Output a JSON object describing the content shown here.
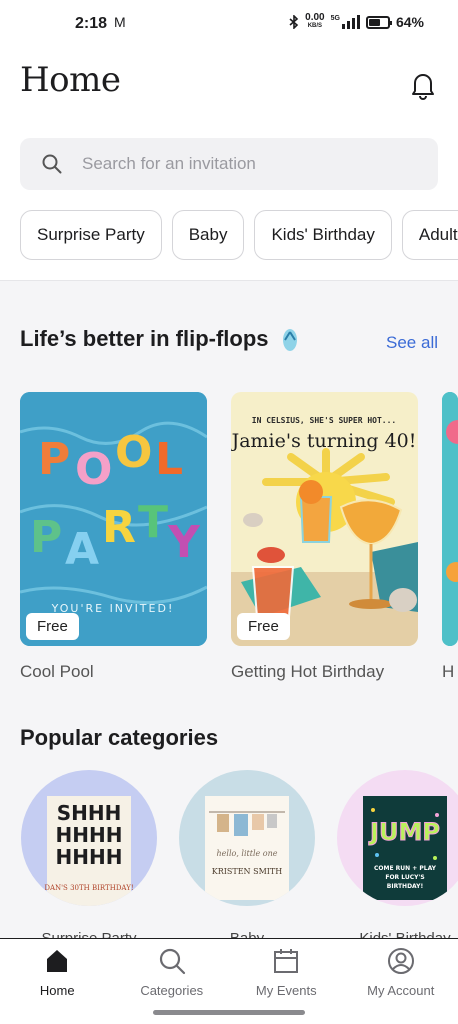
{
  "status_bar": {
    "time": "2:18",
    "mail_icon": "M",
    "speed_value": "0.00",
    "speed_unit": "KB/S",
    "network": "5G",
    "battery": "64%",
    "battery_level": 0.64
  },
  "header": {
    "title": "Home",
    "notification_icon": "bell-icon"
  },
  "search": {
    "placeholder": "Search for an invitation",
    "icon": "search-icon"
  },
  "chips": [
    "Surprise Party",
    "Baby",
    "Kids' Birthday",
    "Adult"
  ],
  "flipflops_section": {
    "title": "Life’s better in flip-flops",
    "see_all": "See all",
    "cards": [
      {
        "name": "Cool Pool",
        "badge": "Free",
        "art_text": "POOL PARTY",
        "art_sub": "YOU'RE INVITED!"
      },
      {
        "name": "Getting Hot Birthday",
        "badge": "Free",
        "art_top": "IN CELSIUS, SHE'S SUPER HOT...",
        "art_title": "Jamie's turning 40!"
      },
      {
        "name": "H"
      }
    ]
  },
  "categories_section": {
    "title": "Popular categories",
    "items": [
      {
        "label": "Surprise Party",
        "art_text": "SHHH HHHH HHHH",
        "art_sub": "DAN'S 30TH BIRTHDAY!",
        "color": "#c5cdf2"
      },
      {
        "label": "Baby",
        "art_text": "hello, little one",
        "art_sub": "KRISTEN SMITH",
        "color": "#c8dde6"
      },
      {
        "label": "Kids' Birthday",
        "art_text": "JUMP",
        "art_sub": "COME RUN + PLAY FOR LUCY'S BIRTHDAY!",
        "color": "#f4dcf3"
      }
    ]
  },
  "bottom_nav": [
    {
      "label": "Home",
      "icon": "home-icon",
      "active": true
    },
    {
      "label": "Categories",
      "icon": "search-icon",
      "active": false
    },
    {
      "label": "My Events",
      "icon": "calendar-icon",
      "active": false
    },
    {
      "label": "My Account",
      "icon": "account-icon",
      "active": false
    }
  ],
  "colors": {
    "accent_link": "#3b6bd6",
    "text": "#1d1d1f",
    "section_bg": "#f5f5f7"
  }
}
